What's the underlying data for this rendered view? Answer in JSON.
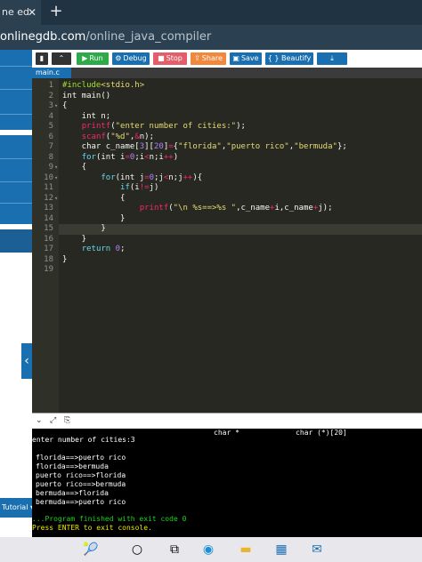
{
  "browser": {
    "tab_title": "ne ed",
    "close_icon": "close-icon",
    "new_tab": "+",
    "url_domain": "onlinegdb.com",
    "url_path": "/online_java_compiler"
  },
  "toolbar": {
    "run": "Run",
    "debug": "Debug",
    "stop": "Stop",
    "share": "Share",
    "save": "Save",
    "beautify": "{ } Beautify"
  },
  "file_tab": "main.c",
  "editor": {
    "line_numbers": [
      "1",
      "2",
      "3",
      "4",
      "5",
      "6",
      "7",
      "8",
      "9",
      "10",
      "11",
      "12",
      "13",
      "14",
      "15",
      "16",
      "17",
      "18",
      "19"
    ]
  },
  "console_headers": {
    "col1": "char *",
    "col2": "char (*)[20]"
  },
  "console": {
    "prompt": "enter number of cities:3",
    "output": [
      "florida==>puerto rico",
      "florida==>bermuda",
      "puerto rico==>florida",
      "puerto rico==>bermuda",
      "bermuda==>florida",
      "bermuda==>puerto rico"
    ],
    "finished": "...Program finished with exit code 0",
    "press_enter": "Press ENTER to exit console."
  },
  "sidebar": {
    "tutorial": "Tutorial"
  },
  "colors": {
    "accent": "#1a6fb0",
    "run": "#2eaa4a",
    "debug": "#1a6fb0",
    "stop": "#e35d6a",
    "share": "#f0883e",
    "save": "#1a6fb0",
    "beautify": "#1a6fb0"
  }
}
